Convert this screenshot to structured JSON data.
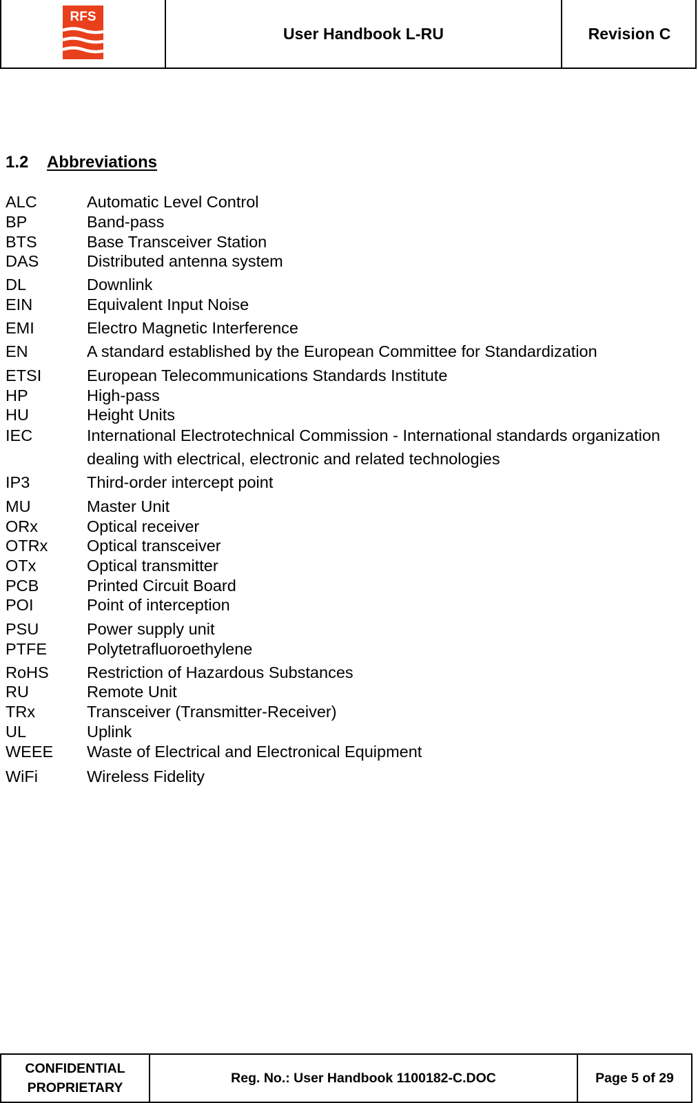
{
  "header": {
    "logo_text": "RFS",
    "logo_color": "#e8401c",
    "title": "User Handbook L-RU",
    "revision": "Revision C"
  },
  "section": {
    "number": "1.2",
    "title": "Abbreviations"
  },
  "abbreviations": [
    {
      "abbr": "ALC",
      "definition": "Automatic Level Control"
    },
    {
      "abbr": "BP",
      "definition": "Band-pass"
    },
    {
      "abbr": "BTS",
      "definition": "Base Transceiver Station"
    },
    {
      "abbr": "DAS",
      "definition": "Distributed antenna system"
    },
    {
      "abbr": "DL",
      "definition": "Downlink"
    },
    {
      "abbr": "EIN",
      "definition": "Equivalent Input Noise"
    },
    {
      "abbr": "EMI",
      "definition": "Electro Magnetic Interference"
    },
    {
      "abbr": "EN",
      "definition": "A standard established by the European Committee for Standardization"
    },
    {
      "abbr": "ETSI",
      "definition": "European Telecommunications Standards Institute"
    },
    {
      "abbr": "HP",
      "definition": "High-pass"
    },
    {
      "abbr": "HU",
      "definition": "Height Units"
    },
    {
      "abbr": "IEC",
      "definition": "International Electrotechnical Commission - International standards organization",
      "definition_line2": "dealing with electrical, electronic and related technologies"
    },
    {
      "abbr": "IP3",
      "definition": "Third-order intercept point"
    },
    {
      "abbr": "MU",
      "definition": "Master Unit"
    },
    {
      "abbr": "ORx",
      "definition": "Optical receiver"
    },
    {
      "abbr": "OTRx",
      "definition": "Optical transceiver"
    },
    {
      "abbr": "OTx",
      "definition": "Optical transmitter"
    },
    {
      "abbr": "PCB",
      "definition": "Printed Circuit Board"
    },
    {
      "abbr": "POI",
      "definition": "Point of interception"
    },
    {
      "abbr": "PSU",
      "definition": "Power supply unit"
    },
    {
      "abbr": "PTFE",
      "definition": "Polytetrafluoroethylene"
    },
    {
      "abbr": "RoHS",
      "definition": "Restriction of Hazardous Substances"
    },
    {
      "abbr": "RU",
      "definition": "Remote Unit"
    },
    {
      "abbr": "TRx",
      "definition": "Transceiver (Transmitter-Receiver)"
    },
    {
      "abbr": "UL",
      "definition": "Uplink"
    },
    {
      "abbr": "WEEE",
      "definition": "Waste of Electrical and Electronical Equipment"
    },
    {
      "abbr": "WiFi",
      "definition": "Wireless Fidelity"
    }
  ],
  "footer": {
    "classification_line1": "CONFIDENTIAL",
    "classification_line2": "PROPRIETARY",
    "reg_no": "Reg. No.: User Handbook 1100182-C.DOC",
    "page": "Page 5 of 29"
  }
}
